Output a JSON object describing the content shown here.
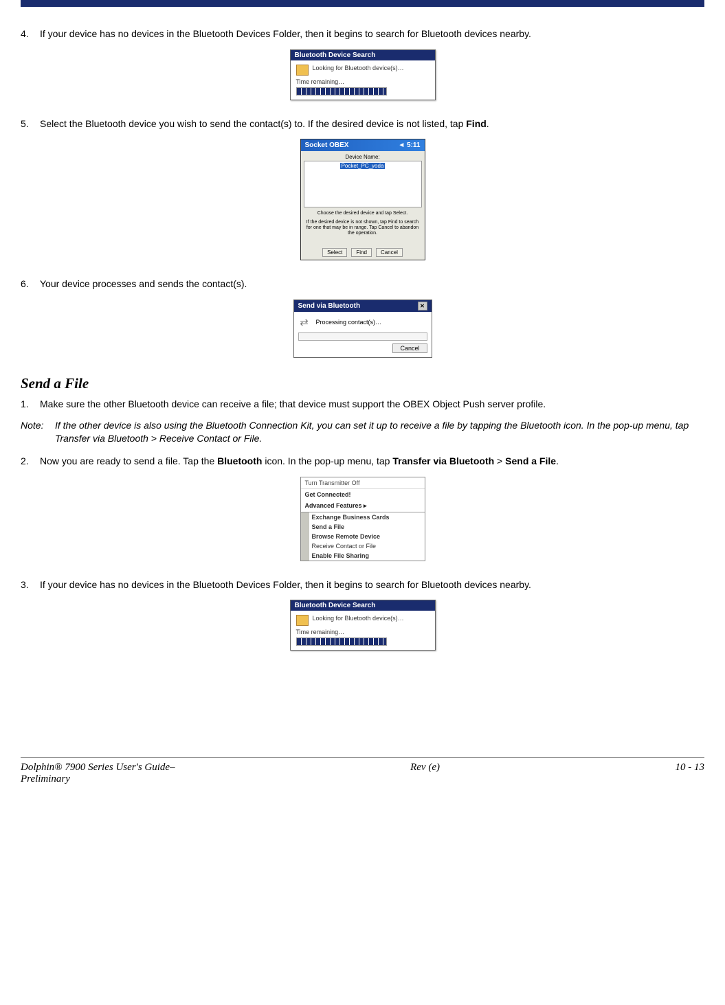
{
  "steps_a": {
    "s4": {
      "num": "4.",
      "text": "If your device has no devices in the Bluetooth Devices Folder, then it begins to search for Bluetooth devices nearby."
    },
    "s5": {
      "num": "5.",
      "pre": "Select the Bluetooth device you wish to send the contact(s) to. If the desired device is not listed, tap ",
      "bold": "Find",
      "post": "."
    },
    "s6": {
      "num": "6.",
      "text": "Your device processes and sends the contact(s)."
    }
  },
  "dlg_search": {
    "title": "Bluetooth Device Search",
    "line1": "Looking for Bluetooth device(s)…",
    "line2": "Time remaining…"
  },
  "ppc": {
    "hdr_left": "Socket OBEX",
    "hdr_right": "◄ 5:11",
    "box_label": "Device Name:",
    "selected": "Pocket_PC_yoda",
    "hint1": "Choose the desired device and tap Select.",
    "hint2": "If the desired device is not shown, tap Find to search for one that may be in range. Tap Cancel to abandon the operation.",
    "btn1": "Select",
    "btn2": "Find",
    "btn3": "Cancel"
  },
  "send": {
    "title": "Send via Bluetooth",
    "msg": "Processing contact(s)…",
    "btn": "Cancel"
  },
  "section_heading": "Send a File",
  "steps_b": {
    "s1": {
      "num": "1.",
      "text": "Make sure the other Bluetooth device can receive a file; that device must support the OBEX Object Push server profile."
    },
    "note": {
      "label": "Note:",
      "text": "If the other device is also using the Bluetooth Connection Kit, you can set it up to receive a file by tapping the Bluetooth icon. In the pop-up menu, tap Transfer via Bluetooth > Receive Contact or File."
    },
    "s2": {
      "num": "2.",
      "pre": "Now you are ready to send a file. Tap the ",
      "b1": "Bluetooth",
      "mid": " icon. In the pop-up menu, tap ",
      "b2": "Transfer via Bluetooth",
      "mid2": " > ",
      "b3": "Send a File",
      "post": "."
    },
    "s3": {
      "num": "3.",
      "text": "If your device has no devices in the Bluetooth Devices Folder, then it begins to search for Bluetooth devices nearby."
    }
  },
  "menu": {
    "m1": "Turn Transmitter Off",
    "m2": "Get Connected!",
    "m3": "Advanced Features      ▸",
    "sub1": "Exchange Business Cards",
    "sub2": "Send a File",
    "sub3": "Browse Remote Device",
    "sub4": "Receive Contact or File",
    "sub5": "Enable File Sharing"
  },
  "footer": {
    "left1": "Dolphin® 7900 Series User's Guide–",
    "left2": "Preliminary",
    "center": "Rev (e)",
    "right": "10 - 13"
  }
}
